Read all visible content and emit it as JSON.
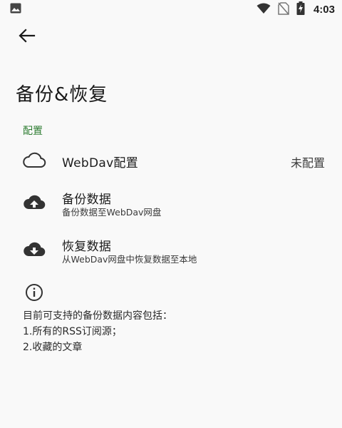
{
  "status_bar": {
    "time": "4:03",
    "left_icons": [
      "image-icon"
    ],
    "right_icons": [
      "wifi-icon",
      "no-sim-icon",
      "battery-charging-icon"
    ]
  },
  "toolbar": {
    "back_icon": "arrow-back-icon"
  },
  "page": {
    "title": "备份&恢复"
  },
  "section": {
    "label": "配置"
  },
  "items": [
    {
      "icon": "cloud-icon",
      "title": "WebDav配置",
      "value": "未配置"
    },
    {
      "icon": "cloud-upload-icon",
      "title": "备份数据",
      "summary": "备份数据至WebDav网盘"
    },
    {
      "icon": "cloud-download-icon",
      "title": "恢复数据",
      "summary": "从WebDav网盘中恢复数据至本地"
    }
  ],
  "info": {
    "icon": "info-icon",
    "lines": [
      "目前可支持的备份数据内容包括：",
      "1.所有的RSS订阅源；",
      "2.收藏的文章"
    ]
  },
  "colors": {
    "background": "#f9f9f9",
    "accent": "#2e7d32",
    "text": "#1c1c1c"
  }
}
